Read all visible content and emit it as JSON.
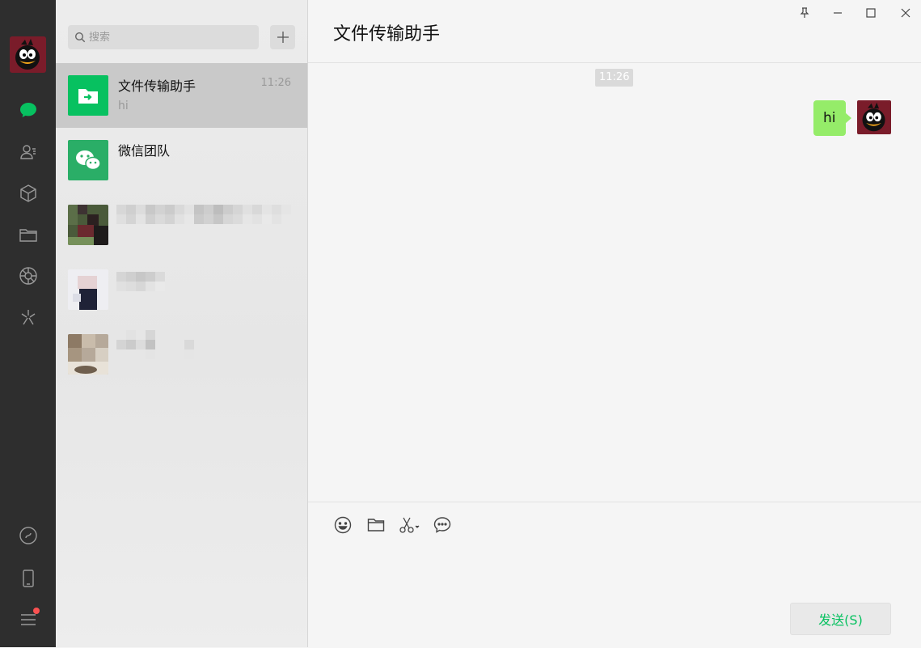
{
  "nav": {
    "profile_avatar": "duck-avatar",
    "items": [
      {
        "name": "chat-icon",
        "active": true
      },
      {
        "name": "contacts-icon"
      },
      {
        "name": "favorites-icon"
      },
      {
        "name": "files-icon"
      },
      {
        "name": "moments-icon"
      },
      {
        "name": "mini-programs-icon"
      }
    ],
    "bottom_items": [
      {
        "name": "mini-programs-panel-icon"
      },
      {
        "name": "phone-icon"
      },
      {
        "name": "menu-icon",
        "has_badge": true
      }
    ],
    "accent": "#07c160",
    "badge_color": "#fa5151"
  },
  "search": {
    "placeholder": "搜索"
  },
  "conversations": [
    {
      "name": "文件传输助手",
      "time": "11:26",
      "preview": "hi",
      "active": true,
      "avatar": "file-transfer-icon"
    },
    {
      "name": "微信团队",
      "time": "",
      "preview": "",
      "avatar": "wechat-team-icon"
    }
  ],
  "chat": {
    "title": "文件传输助手",
    "timestamp": "11:26",
    "messages": [
      {
        "text": "hi",
        "outgoing": true
      }
    ],
    "bubble_color": "#95ec69",
    "toolbar": [
      "emoji-icon",
      "folder-icon",
      "screenshot-icon",
      "chat-history-icon"
    ],
    "send_label": "发送(S)"
  },
  "window_controls": [
    "pin-icon",
    "minimize-icon",
    "maximize-icon",
    "close-icon"
  ]
}
